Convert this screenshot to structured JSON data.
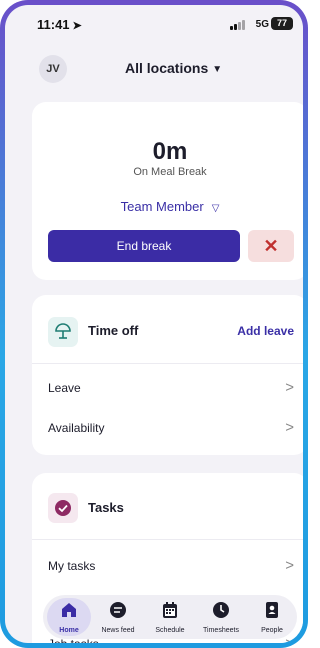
{
  "status": {
    "time": "11:41",
    "network": "5G",
    "battery": "77"
  },
  "header": {
    "avatar": "JV",
    "location": "All locations"
  },
  "break_card": {
    "duration": "0m",
    "state": "On Meal Break",
    "role": "Team Member",
    "end_label": "End break"
  },
  "time_off": {
    "title": "Time off",
    "add_label": "Add leave",
    "items": [
      {
        "label": "Leave"
      },
      {
        "label": "Availability"
      }
    ]
  },
  "tasks": {
    "title": "Tasks",
    "items": [
      {
        "label": "My tasks"
      },
      {
        "label": "Job tasks"
      }
    ]
  },
  "tabs": [
    {
      "label": "Home",
      "icon": "home-icon",
      "active": true
    },
    {
      "label": "News feed",
      "icon": "chat-icon"
    },
    {
      "label": "Schedule",
      "icon": "calendar-icon"
    },
    {
      "label": "Timesheets",
      "icon": "clock-icon"
    },
    {
      "label": "People",
      "icon": "people-icon"
    }
  ],
  "colors": {
    "primary": "#3b2ca5",
    "danger": "#c0302f",
    "task_icon": "#8e2a63"
  }
}
